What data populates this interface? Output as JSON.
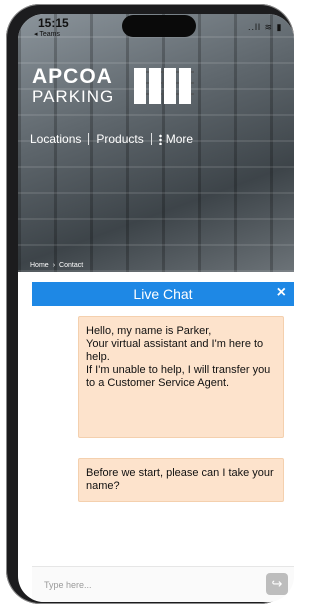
{
  "status_bar": {
    "time": "15:15",
    "back_app": "◂ Teams",
    "signal": "..ll ≋ ▮"
  },
  "header": {
    "logo_top": "APCOA",
    "logo_bottom": "PARKING",
    "nav": [
      "Locations",
      "Products",
      "More"
    ]
  },
  "breadcrumb": [
    "Home",
    "›",
    "Contact"
  ],
  "chat": {
    "title": "Live Chat",
    "close_icon": "×",
    "messages": [
      "Hello, my name is Parker,\nYour virtual assistant and I'm here to help.\nIf I'm unable to help, I will transfer you to a Customer Service Agent.",
      "Before we start, please can I take your name?"
    ],
    "input_placeholder": "Type here...",
    "send_icon": "↪"
  },
  "colors": {
    "chat_header": "#1e88e5",
    "bubble": "#fde3cc"
  }
}
